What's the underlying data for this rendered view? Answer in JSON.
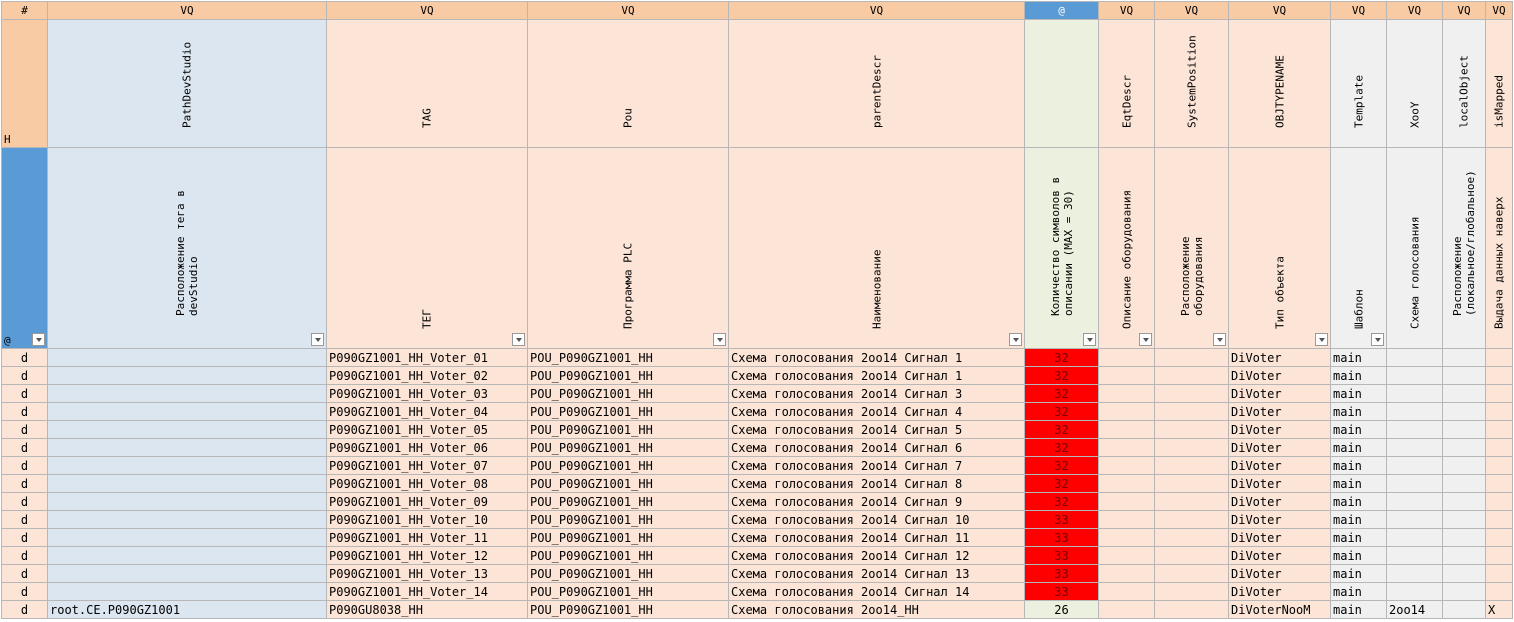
{
  "colors": {
    "header_orange": "#f8cba4",
    "cell_peach": "#fce4d6",
    "cell_blue": "#dce6f1",
    "cell_grey": "#f0f0f0",
    "cell_green": "#ebf1de",
    "accent_blue": "#5b9bd5",
    "alert_red": "#ff0000"
  },
  "row1": {
    "c0": "#",
    "c1": "VQ",
    "c2": "VQ",
    "c3": "VQ",
    "c4": "VQ",
    "c5": "@",
    "c6": "VQ",
    "c7": "VQ",
    "c8": "VQ",
    "c9": "VQ",
    "c10": "VQ",
    "c11": "VQ",
    "c12": "VQ"
  },
  "row2": {
    "c0": "H",
    "c1": "PathDevStudio",
    "c2": "TAG",
    "c3": "Pou",
    "c4": "parentDescr",
    "c5": "",
    "c6": "EqtDescr",
    "c7": "SystemPosition",
    "c8": "OBJTYPENAME",
    "c9": "Template",
    "c10": "XooY",
    "c11": "localObject",
    "c12": "isMapped"
  },
  "row3": {
    "c0": "@",
    "c1": "Расположение тега в\ndevStudio",
    "c2": "ТЕГ",
    "c3": "Программа PLC",
    "c4": "Наименование",
    "c5": "Количество символов в\nописании (MAX = 30)",
    "c6": "Описание оборудования",
    "c7": "Расположение\nоборудования",
    "c8": "Тип объекта",
    "c9": "Шаблон",
    "c10": "Схема голосования",
    "c11": "Расположение\n(локальное/глобальное)",
    "c12": "Выдача данных наверх"
  },
  "rows": [
    {
      "flag": "d",
      "path": "",
      "tag": "P090GZ1001_HH_Voter_01",
      "pou": "POU_P090GZ1001_HH",
      "descr": "Схема голосования 2oo14 Сигнал 1",
      "count": "32",
      "eqt": "",
      "syspos": "",
      "objtype": "DiVoter",
      "template": "main",
      "xooy": "",
      "local": "",
      "mapped": ""
    },
    {
      "flag": "d",
      "path": "",
      "tag": "P090GZ1001_HH_Voter_02",
      "pou": "POU_P090GZ1001_HH",
      "descr": "Схема голосования 2oo14 Сигнал 1",
      "count": "32",
      "eqt": "",
      "syspos": "",
      "objtype": "DiVoter",
      "template": "main",
      "xooy": "",
      "local": "",
      "mapped": ""
    },
    {
      "flag": "d",
      "path": "",
      "tag": "P090GZ1001_HH_Voter_03",
      "pou": "POU_P090GZ1001_HH",
      "descr": "Схема голосования 2oo14 Сигнал 3",
      "count": "32",
      "eqt": "",
      "syspos": "",
      "objtype": "DiVoter",
      "template": "main",
      "xooy": "",
      "local": "",
      "mapped": ""
    },
    {
      "flag": "d",
      "path": "",
      "tag": "P090GZ1001_HH_Voter_04",
      "pou": "POU_P090GZ1001_HH",
      "descr": "Схема голосования 2oo14 Сигнал 4",
      "count": "32",
      "eqt": "",
      "syspos": "",
      "objtype": "DiVoter",
      "template": "main",
      "xooy": "",
      "local": "",
      "mapped": ""
    },
    {
      "flag": "d",
      "path": "",
      "tag": "P090GZ1001_HH_Voter_05",
      "pou": "POU_P090GZ1001_HH",
      "descr": "Схема голосования 2oo14 Сигнал 5",
      "count": "32",
      "eqt": "",
      "syspos": "",
      "objtype": "DiVoter",
      "template": "main",
      "xooy": "",
      "local": "",
      "mapped": ""
    },
    {
      "flag": "d",
      "path": "",
      "tag": "P090GZ1001_HH_Voter_06",
      "pou": "POU_P090GZ1001_HH",
      "descr": "Схема голосования 2oo14 Сигнал 6",
      "count": "32",
      "eqt": "",
      "syspos": "",
      "objtype": "DiVoter",
      "template": "main",
      "xooy": "",
      "local": "",
      "mapped": ""
    },
    {
      "flag": "d",
      "path": "",
      "tag": "P090GZ1001_HH_Voter_07",
      "pou": "POU_P090GZ1001_HH",
      "descr": "Схема голосования 2oo14 Сигнал 7",
      "count": "32",
      "eqt": "",
      "syspos": "",
      "objtype": "DiVoter",
      "template": "main",
      "xooy": "",
      "local": "",
      "mapped": ""
    },
    {
      "flag": "d",
      "path": "",
      "tag": "P090GZ1001_HH_Voter_08",
      "pou": "POU_P090GZ1001_HH",
      "descr": "Схема голосования 2oo14 Сигнал 8",
      "count": "32",
      "eqt": "",
      "syspos": "",
      "objtype": "DiVoter",
      "template": "main",
      "xooy": "",
      "local": "",
      "mapped": ""
    },
    {
      "flag": "d",
      "path": "",
      "tag": "P090GZ1001_HH_Voter_09",
      "pou": "POU_P090GZ1001_HH",
      "descr": "Схема голосования 2oo14 Сигнал 9",
      "count": "32",
      "eqt": "",
      "syspos": "",
      "objtype": "DiVoter",
      "template": "main",
      "xooy": "",
      "local": "",
      "mapped": ""
    },
    {
      "flag": "d",
      "path": "",
      "tag": "P090GZ1001_HH_Voter_10",
      "pou": "POU_P090GZ1001_HH",
      "descr": "Схема голосования 2oo14 Сигнал 10",
      "count": "33",
      "eqt": "",
      "syspos": "",
      "objtype": "DiVoter",
      "template": "main",
      "xooy": "",
      "local": "",
      "mapped": ""
    },
    {
      "flag": "d",
      "path": "",
      "tag": "P090GZ1001_HH_Voter_11",
      "pou": "POU_P090GZ1001_HH",
      "descr": "Схема голосования 2oo14 Сигнал 11",
      "count": "33",
      "eqt": "",
      "syspos": "",
      "objtype": "DiVoter",
      "template": "main",
      "xooy": "",
      "local": "",
      "mapped": ""
    },
    {
      "flag": "d",
      "path": "",
      "tag": "P090GZ1001_HH_Voter_12",
      "pou": "POU_P090GZ1001_HH",
      "descr": "Схема голосования 2oo14 Сигнал 12",
      "count": "33",
      "eqt": "",
      "syspos": "",
      "objtype": "DiVoter",
      "template": "main",
      "xooy": "",
      "local": "",
      "mapped": ""
    },
    {
      "flag": "d",
      "path": "",
      "tag": "P090GZ1001_HH_Voter_13",
      "pou": "POU_P090GZ1001_HH",
      "descr": "Схема голосования 2oo14 Сигнал 13",
      "count": "33",
      "eqt": "",
      "syspos": "",
      "objtype": "DiVoter",
      "template": "main",
      "xooy": "",
      "local": "",
      "mapped": ""
    },
    {
      "flag": "d",
      "path": "",
      "tag": "P090GZ1001_HH_Voter_14",
      "pou": "POU_P090GZ1001_HH",
      "descr": "Схема голосования 2oo14 Сигнал 14",
      "count": "33",
      "eqt": "",
      "syspos": "",
      "objtype": "DiVoter",
      "template": "main",
      "xooy": "",
      "local": "",
      "mapped": ""
    },
    {
      "flag": "d",
      "path": "root.CE.P090GZ1001",
      "tag": "P090GU8038_HH",
      "pou": "POU_P090GZ1001_HH",
      "descr": "Схема голосования 2oo14_HH",
      "count": "26",
      "eqt": "",
      "syspos": "",
      "objtype": "DiVoterNooM",
      "template": "main",
      "xooy": "2oo14",
      "local": "",
      "mapped": "X"
    }
  ]
}
